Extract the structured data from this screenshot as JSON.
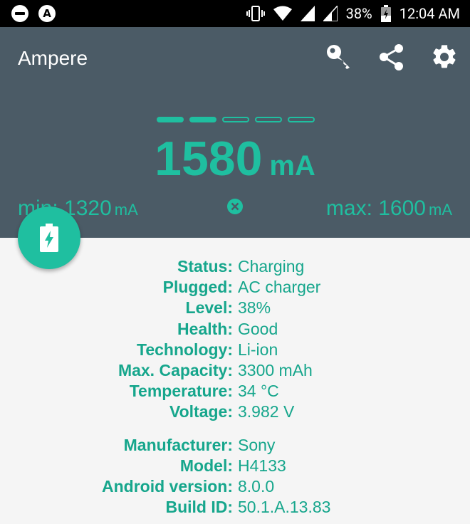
{
  "status_bar": {
    "battery": "38%",
    "time": "12:04 AM"
  },
  "app": {
    "title": "Ampere",
    "actions": [
      "key-icon",
      "share-icon",
      "gear-icon"
    ]
  },
  "meter": {
    "page_indicator": [
      true,
      true,
      false,
      false,
      false
    ],
    "current_value": "1580",
    "current_unit": "mA",
    "min_label": "min: 1320",
    "min_unit": "mA",
    "max_label": "max: 1600",
    "max_unit": "mA"
  },
  "battery_info": {
    "status_label": "Status:",
    "status": "Charging",
    "plugged_label": "Plugged:",
    "plugged": "AC charger",
    "level_label": "Level:",
    "level": "38%",
    "health_label": "Health:",
    "health": "Good",
    "technology_label": "Technology:",
    "technology": "Li-ion",
    "capacity_label": "Max. Capacity:",
    "capacity": "3300 mAh",
    "temperature_label": "Temperature:",
    "temperature": "34 °C",
    "voltage_label": "Voltage:",
    "voltage": "3.982 V"
  },
  "device_info": {
    "manufacturer_label": "Manufacturer:",
    "manufacturer": "Sony",
    "model_label": "Model:",
    "model": "H4133",
    "android_label": "Android version:",
    "android": "8.0.0",
    "build_label": "Build ID:",
    "build": "50.1.A.13.83"
  },
  "colors": {
    "accent": "#1fbfa0",
    "appbar": "#4b5b66",
    "background": "#f5f5f5"
  }
}
